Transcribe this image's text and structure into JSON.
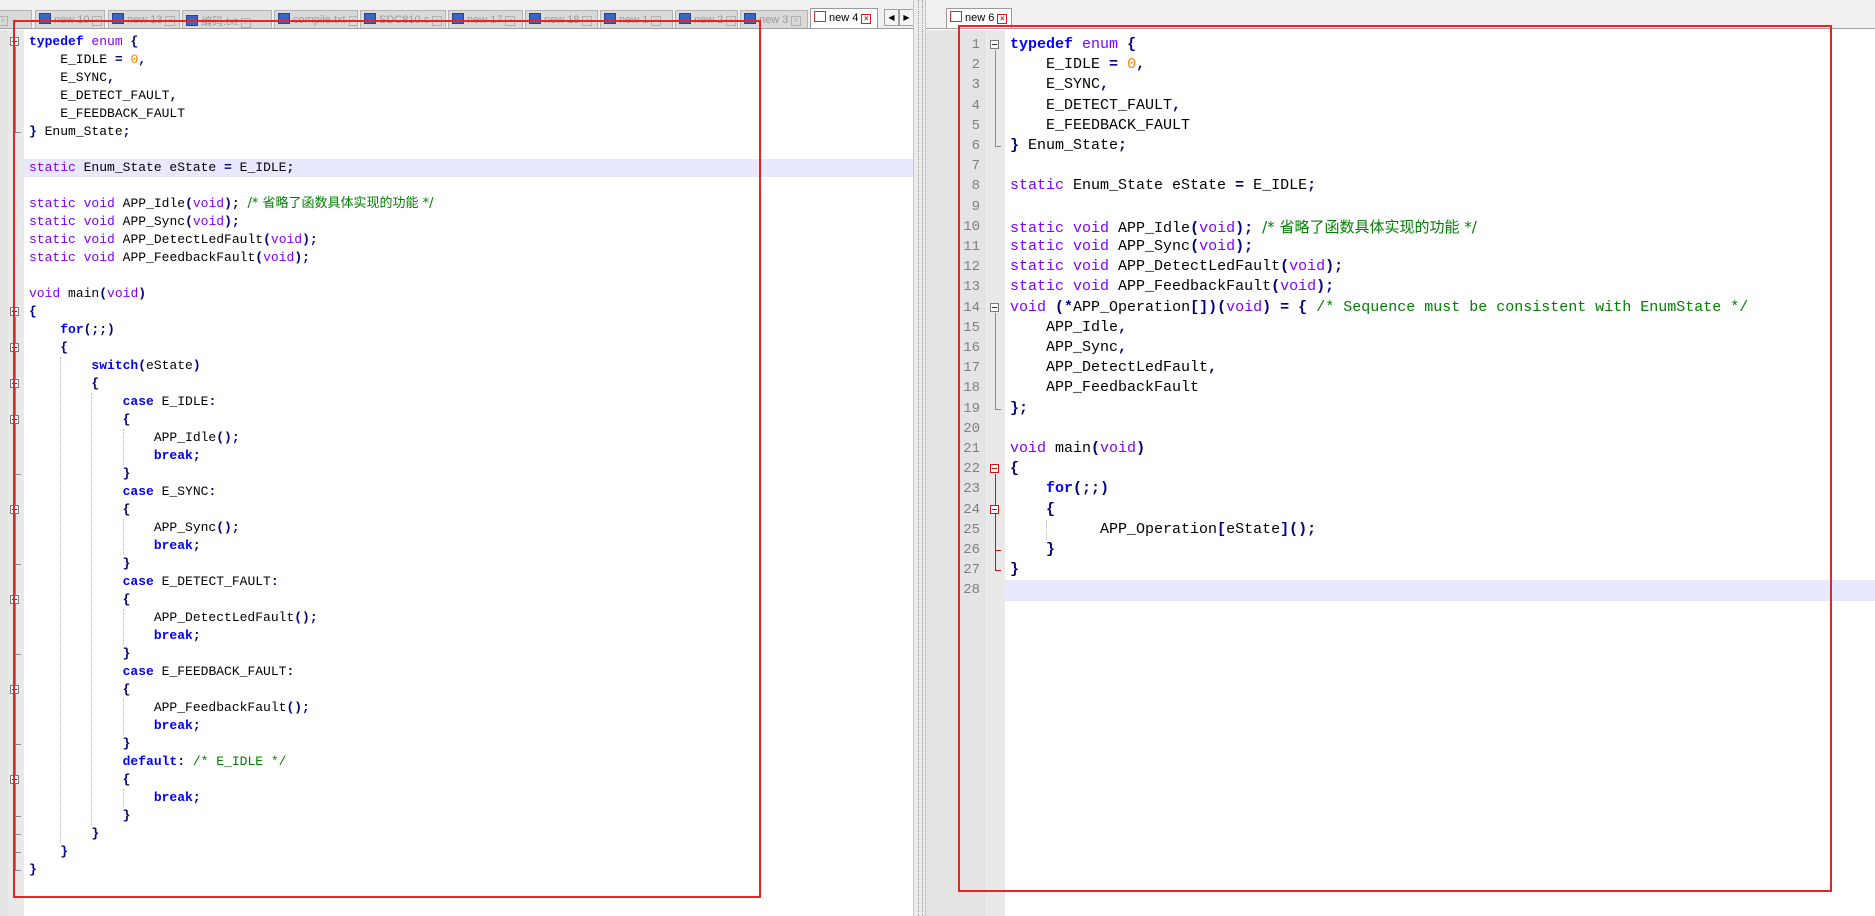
{
  "left_tabs": [
    {
      "label": "9"
    },
    {
      "label": "new 10"
    },
    {
      "label": "new 13"
    },
    {
      "label": "编码.txt"
    },
    {
      "label": "compile.txt"
    },
    {
      "label": "SDC810.c"
    },
    {
      "label": "new 17"
    },
    {
      "label": "new 18"
    },
    {
      "label": "new 1"
    },
    {
      "label": "new 2"
    },
    {
      "label": "new 3"
    },
    {
      "label": "new 4",
      "active": true
    }
  ],
  "right_tabs": [
    {
      "label": "new 6",
      "active": true
    }
  ],
  "left_code": [
    [
      [
        "kw",
        "typedef"
      ],
      [
        "t",
        " "
      ],
      [
        "ty",
        "enum"
      ],
      [
        "t",
        " "
      ],
      [
        "op",
        "{"
      ]
    ],
    [
      [
        "t",
        "    E_IDLE "
      ],
      [
        "op",
        "="
      ],
      [
        "t",
        " "
      ],
      [
        "num",
        "0"
      ],
      [
        "op",
        ","
      ]
    ],
    [
      [
        "t",
        "    E_SYNC"
      ],
      [
        "op",
        ","
      ]
    ],
    [
      [
        "t",
        "    E_DETECT_FAULT"
      ],
      [
        "op",
        ","
      ]
    ],
    [
      [
        "t",
        "    E_FEEDBACK_FAULT"
      ]
    ],
    [
      [
        "op",
        "}"
      ],
      [
        "t",
        " Enum_State"
      ],
      [
        "op",
        ";"
      ]
    ],
    [],
    [
      [
        "ty",
        "static"
      ],
      [
        "t",
        " Enum_State eState "
      ],
      [
        "op",
        "="
      ],
      [
        "t",
        " E_IDLE"
      ],
      [
        "op",
        ";"
      ]
    ],
    [],
    [
      [
        "ty",
        "static"
      ],
      [
        "t",
        " "
      ],
      [
        "ty",
        "void"
      ],
      [
        "t",
        " APP_Idle"
      ],
      [
        "op",
        "("
      ],
      [
        "ty",
        "void"
      ],
      [
        "op",
        ");"
      ],
      [
        "t",
        " "
      ],
      [
        "cmt",
        "/* 省略了函数具体实现的功能 */"
      ]
    ],
    [
      [
        "ty",
        "static"
      ],
      [
        "t",
        " "
      ],
      [
        "ty",
        "void"
      ],
      [
        "t",
        " APP_Sync"
      ],
      [
        "op",
        "("
      ],
      [
        "ty",
        "void"
      ],
      [
        "op",
        ");"
      ]
    ],
    [
      [
        "ty",
        "static"
      ],
      [
        "t",
        " "
      ],
      [
        "ty",
        "void"
      ],
      [
        "t",
        " APP_DetectLedFault"
      ],
      [
        "op",
        "("
      ],
      [
        "ty",
        "void"
      ],
      [
        "op",
        ");"
      ]
    ],
    [
      [
        "ty",
        "static"
      ],
      [
        "t",
        " "
      ],
      [
        "ty",
        "void"
      ],
      [
        "t",
        " APP_FeedbackFault"
      ],
      [
        "op",
        "("
      ],
      [
        "ty",
        "void"
      ],
      [
        "op",
        ");"
      ]
    ],
    [],
    [
      [
        "ty",
        "void"
      ],
      [
        "t",
        " main"
      ],
      [
        "op",
        "("
      ],
      [
        "ty",
        "void"
      ],
      [
        "op",
        ")"
      ]
    ],
    [
      [
        "op",
        "{"
      ]
    ],
    [
      [
        "t",
        "    "
      ],
      [
        "kw",
        "for"
      ],
      [
        "op",
        "(;;)"
      ]
    ],
    [
      [
        "t",
        "    "
      ],
      [
        "op",
        "{"
      ]
    ],
    [
      [
        "t",
        "        "
      ],
      [
        "kw",
        "switch"
      ],
      [
        "op",
        "("
      ],
      [
        "t",
        "eState"
      ],
      [
        "op",
        ")"
      ]
    ],
    [
      [
        "t",
        "        "
      ],
      [
        "op",
        "{"
      ]
    ],
    [
      [
        "t",
        "            "
      ],
      [
        "kw",
        "case"
      ],
      [
        "t",
        " E_IDLE"
      ],
      [
        "op",
        ":"
      ]
    ],
    [
      [
        "t",
        "            "
      ],
      [
        "op",
        "{"
      ]
    ],
    [
      [
        "t",
        "                APP_Idle"
      ],
      [
        "op",
        "();"
      ]
    ],
    [
      [
        "t",
        "                "
      ],
      [
        "kw",
        "break"
      ],
      [
        "op",
        ";"
      ]
    ],
    [
      [
        "t",
        "            "
      ],
      [
        "op",
        "}"
      ]
    ],
    [
      [
        "t",
        "            "
      ],
      [
        "kw",
        "case"
      ],
      [
        "t",
        " E_SYNC"
      ],
      [
        "op",
        ":"
      ]
    ],
    [
      [
        "t",
        "            "
      ],
      [
        "op",
        "{"
      ]
    ],
    [
      [
        "t",
        "                APP_Sync"
      ],
      [
        "op",
        "();"
      ]
    ],
    [
      [
        "t",
        "                "
      ],
      [
        "kw",
        "break"
      ],
      [
        "op",
        ";"
      ]
    ],
    [
      [
        "t",
        "            "
      ],
      [
        "op",
        "}"
      ]
    ],
    [
      [
        "t",
        "            "
      ],
      [
        "kw",
        "case"
      ],
      [
        "t",
        " E_DETECT_FAULT"
      ],
      [
        "op",
        ":"
      ]
    ],
    [
      [
        "t",
        "            "
      ],
      [
        "op",
        "{"
      ]
    ],
    [
      [
        "t",
        "                APP_DetectLedFault"
      ],
      [
        "op",
        "();"
      ]
    ],
    [
      [
        "t",
        "                "
      ],
      [
        "kw",
        "break"
      ],
      [
        "op",
        ";"
      ]
    ],
    [
      [
        "t",
        "            "
      ],
      [
        "op",
        "}"
      ]
    ],
    [
      [
        "t",
        "            "
      ],
      [
        "kw",
        "case"
      ],
      [
        "t",
        " E_FEEDBACK_FAULT"
      ],
      [
        "op",
        ":"
      ]
    ],
    [
      [
        "t",
        "            "
      ],
      [
        "op",
        "{"
      ]
    ],
    [
      [
        "t",
        "                APP_FeedbackFault"
      ],
      [
        "op",
        "();"
      ]
    ],
    [
      [
        "t",
        "                "
      ],
      [
        "kw",
        "break"
      ],
      [
        "op",
        ";"
      ]
    ],
    [
      [
        "t",
        "            "
      ],
      [
        "op",
        "}"
      ]
    ],
    [
      [
        "t",
        "            "
      ],
      [
        "kw",
        "default"
      ],
      [
        "op",
        ":"
      ],
      [
        "t",
        " "
      ],
      [
        "cmt",
        "/* E_IDLE */"
      ]
    ],
    [
      [
        "t",
        "            "
      ],
      [
        "op",
        "{"
      ]
    ],
    [
      [
        "t",
        "                "
      ],
      [
        "kw",
        "break"
      ],
      [
        "op",
        ";"
      ]
    ],
    [
      [
        "t",
        "            "
      ],
      [
        "op",
        "}"
      ]
    ],
    [
      [
        "t",
        "        "
      ],
      [
        "op",
        "}"
      ]
    ],
    [
      [
        "t",
        "    "
      ],
      [
        "op",
        "}"
      ]
    ],
    [
      [
        "op",
        "}"
      ]
    ]
  ],
  "right_line_numbers": [
    "1",
    "2",
    "3",
    "4",
    "5",
    "6",
    "7",
    "8",
    "9",
    "10",
    "11",
    "12",
    "13",
    "14",
    "15",
    "16",
    "17",
    "18",
    "19",
    "20",
    "21",
    "22",
    "23",
    "24",
    "25",
    "26",
    "27",
    "28"
  ],
  "right_code": [
    [
      [
        "kw",
        "typedef"
      ],
      [
        "t",
        " "
      ],
      [
        "ty",
        "enum"
      ],
      [
        "t",
        " "
      ],
      [
        "op",
        "{"
      ]
    ],
    [
      [
        "t",
        "    E_IDLE "
      ],
      [
        "op",
        "="
      ],
      [
        "t",
        " "
      ],
      [
        "num",
        "0"
      ],
      [
        "op",
        ","
      ]
    ],
    [
      [
        "t",
        "    E_SYNC"
      ],
      [
        "op",
        ","
      ]
    ],
    [
      [
        "t",
        "    E_DETECT_FAULT"
      ],
      [
        "op",
        ","
      ]
    ],
    [
      [
        "t",
        "    E_FEEDBACK_FAULT"
      ]
    ],
    [
      [
        "op",
        "}"
      ],
      [
        "t",
        " Enum_State"
      ],
      [
        "op",
        ";"
      ]
    ],
    [],
    [
      [
        "ty",
        "static"
      ],
      [
        "t",
        " Enum_State eState "
      ],
      [
        "op",
        "="
      ],
      [
        "t",
        " E_IDLE"
      ],
      [
        "op",
        ";"
      ]
    ],
    [],
    [
      [
        "ty",
        "static"
      ],
      [
        "t",
        " "
      ],
      [
        "ty",
        "void"
      ],
      [
        "t",
        " APP_Idle"
      ],
      [
        "op",
        "("
      ],
      [
        "ty",
        "void"
      ],
      [
        "op",
        ");"
      ],
      [
        "t",
        " "
      ],
      [
        "cmt",
        "/* 省略了函数具体实现的功能 */"
      ]
    ],
    [
      [
        "ty",
        "static"
      ],
      [
        "t",
        " "
      ],
      [
        "ty",
        "void"
      ],
      [
        "t",
        " APP_Sync"
      ],
      [
        "op",
        "("
      ],
      [
        "ty",
        "void"
      ],
      [
        "op",
        ");"
      ]
    ],
    [
      [
        "ty",
        "static"
      ],
      [
        "t",
        " "
      ],
      [
        "ty",
        "void"
      ],
      [
        "t",
        " APP_DetectLedFault"
      ],
      [
        "op",
        "("
      ],
      [
        "ty",
        "void"
      ],
      [
        "op",
        ");"
      ]
    ],
    [
      [
        "ty",
        "static"
      ],
      [
        "t",
        " "
      ],
      [
        "ty",
        "void"
      ],
      [
        "t",
        " APP_FeedbackFault"
      ],
      [
        "op",
        "("
      ],
      [
        "ty",
        "void"
      ],
      [
        "op",
        ");"
      ]
    ],
    [
      [
        "ty",
        "void"
      ],
      [
        "t",
        " "
      ],
      [
        "op",
        "(*"
      ],
      [
        "t",
        "APP_Operation"
      ],
      [
        "op",
        "[])("
      ],
      [
        "ty",
        "void"
      ],
      [
        "op",
        ")"
      ],
      [
        "t",
        " "
      ],
      [
        "op",
        "="
      ],
      [
        "t",
        " "
      ],
      [
        "op",
        "{"
      ],
      [
        "t",
        " "
      ],
      [
        "cmt",
        "/* Sequence must be consistent with EnumState */"
      ]
    ],
    [
      [
        "t",
        "    APP_Idle"
      ],
      [
        "op",
        ","
      ]
    ],
    [
      [
        "t",
        "    APP_Sync"
      ],
      [
        "op",
        ","
      ]
    ],
    [
      [
        "t",
        "    APP_DetectLedFault"
      ],
      [
        "op",
        ","
      ]
    ],
    [
      [
        "t",
        "    APP_FeedbackFault"
      ]
    ],
    [
      [
        "op",
        "};"
      ]
    ],
    [],
    [
      [
        "ty",
        "void"
      ],
      [
        "t",
        " main"
      ],
      [
        "op",
        "("
      ],
      [
        "ty",
        "void"
      ],
      [
        "op",
        ")"
      ]
    ],
    [
      [
        "op",
        "{"
      ]
    ],
    [
      [
        "t",
        "    "
      ],
      [
        "kw",
        "for"
      ],
      [
        "op",
        "(;;)"
      ]
    ],
    [
      [
        "t",
        "    "
      ],
      [
        "op",
        "{"
      ]
    ],
    [
      [
        "t",
        "          APP_Operation"
      ],
      [
        "op",
        "["
      ],
      [
        "t",
        "eState"
      ],
      [
        "op",
        "]();"
      ]
    ],
    [
      [
        "t",
        "    "
      ],
      [
        "op",
        "}"
      ]
    ],
    [
      [
        "op",
        "}"
      ]
    ],
    []
  ],
  "colors": {
    "keyword": "#0000ff",
    "type": "#8000ff",
    "number": "#ff8000",
    "operator": "#000080",
    "comment": "#008000",
    "current_line": "#e8e8ff",
    "annotation_box": "#e8261f"
  }
}
